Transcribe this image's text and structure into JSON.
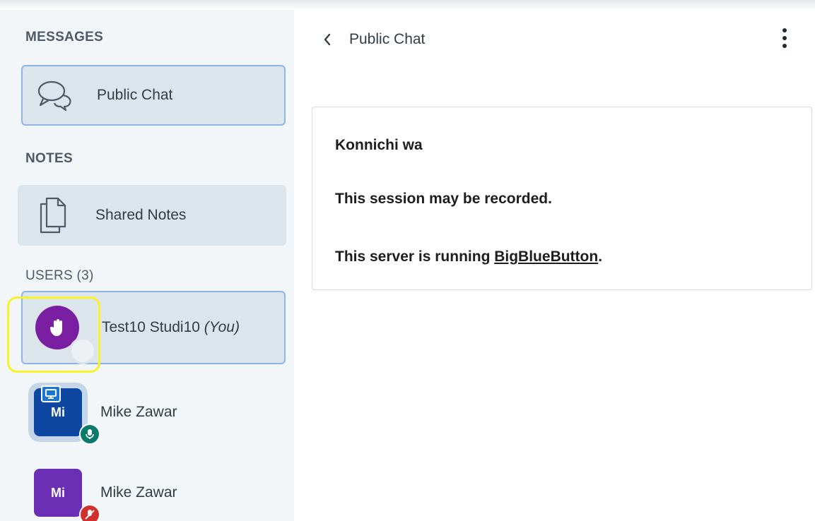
{
  "sidebar": {
    "messages_title": "MESSAGES",
    "public_chat_label": "Public Chat",
    "notes_title": "NOTES",
    "shared_notes_label": "Shared Notes",
    "users_title": "USERS (3)",
    "users": [
      {
        "name": "Test10 Studi10",
        "suffix": "(You)",
        "avatar_color": "#7b1fa2",
        "status": "raised-hand"
      },
      {
        "name": "Mike Zawar",
        "initials": "Mi",
        "avatar_color": "#0d47a1",
        "presenter": true,
        "mic": "on"
      },
      {
        "name": "Mike Zawar",
        "initials": "Mi",
        "avatar_color": "#6a2fb5",
        "mic": "muted"
      }
    ]
  },
  "chat": {
    "back_icon": "chevron-left-icon",
    "title": "Public Chat",
    "menu_icon": "kebab-menu-icon",
    "welcome": {
      "line1": "Konnichi wa",
      "line2": "This session may be recorded.",
      "line3_prefix": "This server is running ",
      "line3_link": "BigBlueButton",
      "line3_suffix": "."
    }
  },
  "colors": {
    "sidebar_bg": "#f3f6f9",
    "selected_bg": "#dce4ec",
    "selected_border": "#8fb4e6",
    "highlight": "#f7f22a"
  }
}
